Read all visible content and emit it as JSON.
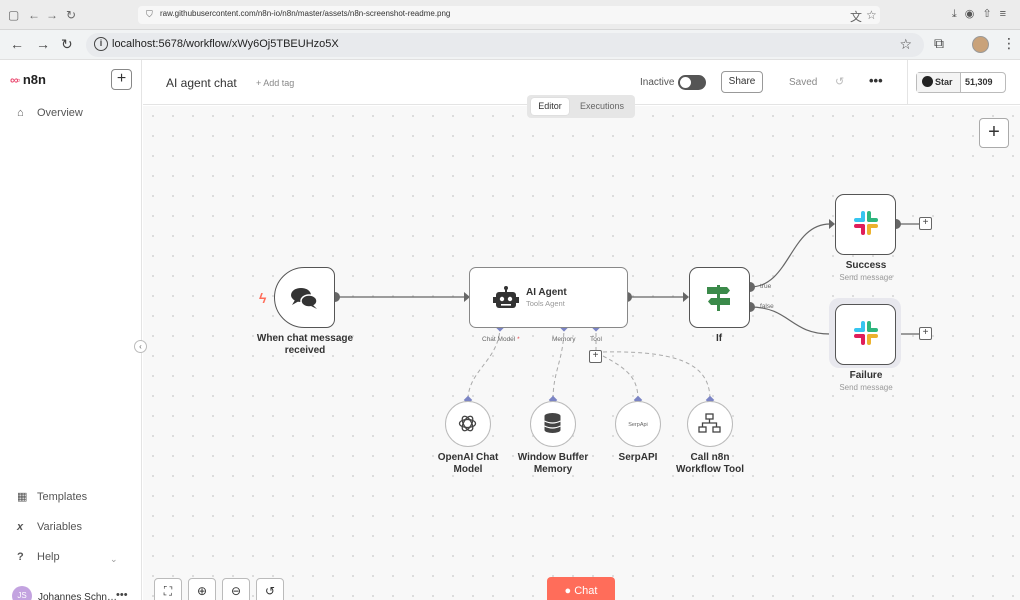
{
  "outer_browser": {
    "url": "raw.githubusercontent.com/n8n-io/n8n/master/assets/n8n-screenshot-readme.png"
  },
  "browser": {
    "url": "localhost:5678/workflow/xWy6Oj5TBEUHzo5X"
  },
  "sidebar": {
    "brand": "n8n",
    "top_items": [
      {
        "label": "Overview",
        "icon": "home-icon"
      }
    ],
    "bottom_items": [
      {
        "label": "Templates",
        "icon": "templates-icon"
      },
      {
        "label": "Variables",
        "icon": "variables-icon"
      },
      {
        "label": "Help",
        "icon": "help-icon"
      }
    ],
    "user": {
      "name": "Johannes Schn…",
      "initials": "JS"
    }
  },
  "header": {
    "workflow_name": "AI agent chat",
    "add_tag": "+ Add tag",
    "status_label": "Inactive",
    "active": false,
    "share_label": "Share",
    "saved_label": "Saved",
    "github": {
      "star_label": "Star",
      "count": "51,309"
    }
  },
  "view_tabs": [
    {
      "label": "Editor",
      "active": true
    },
    {
      "label": "Executions",
      "active": false
    }
  ],
  "nodes": {
    "trigger": {
      "label": "When chat message received",
      "icon": "chat-bubbles-icon"
    },
    "agent": {
      "title": "AI Agent",
      "subtitle": "Tools Agent",
      "icon": "robot-icon",
      "ports": [
        {
          "label": "Chat Model",
          "required": "*"
        },
        {
          "label": "Memory"
        },
        {
          "label": "Tool"
        }
      ]
    },
    "if": {
      "label": "If",
      "icon": "signpost-icon",
      "outputs": [
        "true",
        "false"
      ]
    },
    "success": {
      "label": "Success",
      "sub": "Send message",
      "icon": "slack-icon"
    },
    "failure": {
      "label": "Failure",
      "sub": "Send message",
      "icon": "slack-icon"
    },
    "openai": {
      "label": "OpenAI Chat Model",
      "icon": "openai-icon"
    },
    "memory": {
      "label": "Window Buffer Memory",
      "icon": "database-icon"
    },
    "serpapi": {
      "label": "SerpAPI",
      "icon_text": "SerpApi"
    },
    "call_workflow": {
      "label": "Call n8n Workflow Tool",
      "icon": "sitemap-icon"
    }
  },
  "footer": {
    "chat_label": "Chat",
    "controls": [
      "fit-view-icon",
      "zoom-in-icon",
      "zoom-out-icon",
      "reset-icon"
    ]
  },
  "colors": {
    "accent": "#ff6d5a",
    "brand": "#ea4b71"
  }
}
